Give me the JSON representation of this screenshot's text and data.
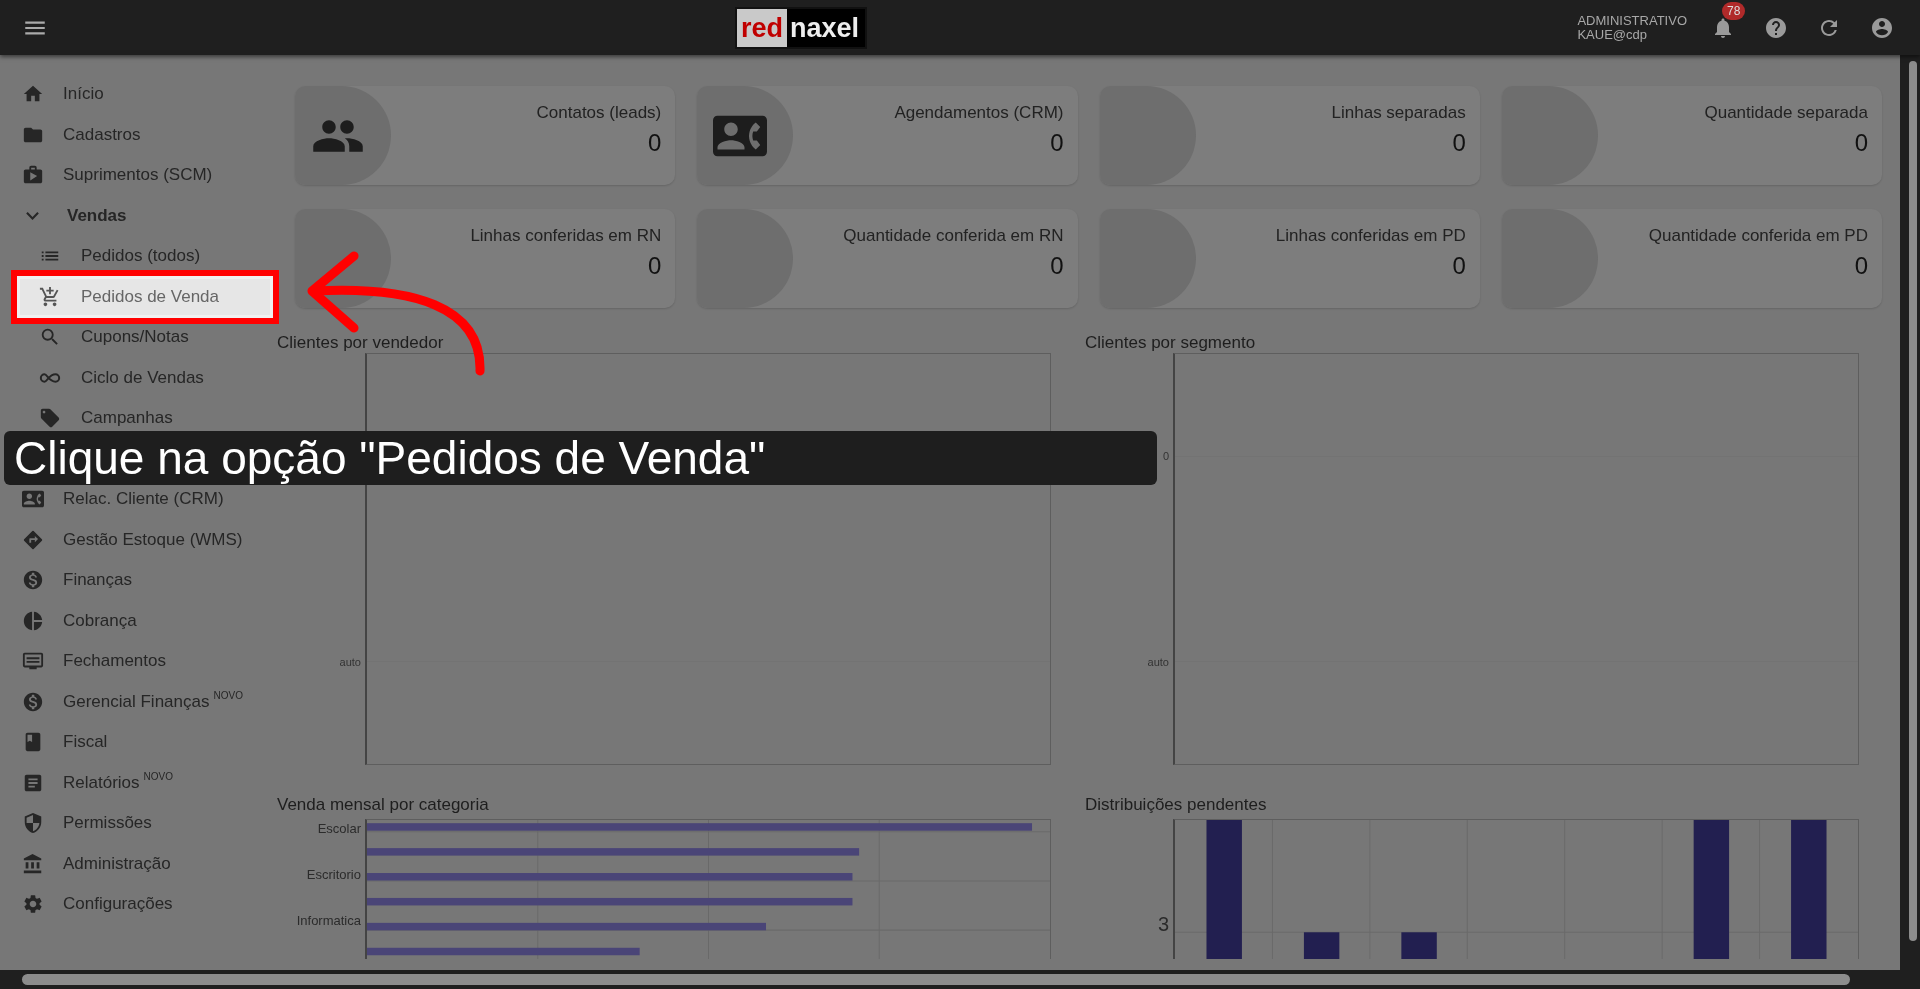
{
  "topbar": {
    "logo": {
      "part_1": "red",
      "part_2": "naxel"
    },
    "user": {
      "role": "ADMINISTRATIVO",
      "login": "KAUE@cdp"
    },
    "notifications": {
      "count": "78"
    }
  },
  "sidebar": {
    "items": [
      {
        "label": "Início"
      },
      {
        "label": "Cadastros"
      },
      {
        "label": "Suprimentos (SCM)"
      },
      {
        "label": "Vendas",
        "expanded": true,
        "children": [
          {
            "label": "Pedidos (todos)",
            "selected": false
          },
          {
            "label": "Pedidos de Venda",
            "selected": true
          },
          {
            "label": "Cupons/Notas",
            "selected": false
          },
          {
            "label": "Ciclo de Vendas",
            "selected": false
          },
          {
            "label": "Campanhas",
            "selected": false
          }
        ]
      },
      {
        "label": "Relac. Cliente (CRM)"
      },
      {
        "label": "Gestão Estoque (WMS)"
      },
      {
        "label": "Finanças"
      },
      {
        "label": "Cobrança"
      },
      {
        "label": "Fechamentos"
      },
      {
        "label": "Gerencial Finanças",
        "badge": "NOVO"
      },
      {
        "label": "Fiscal"
      },
      {
        "label": "Relatórios",
        "badge": "NOVO"
      },
      {
        "label": "Permissões"
      },
      {
        "label": "Administração"
      },
      {
        "label": "Configurações"
      }
    ]
  },
  "cards": [
    {
      "label": "Contatos (leads)",
      "value": "0"
    },
    {
      "label": "Agendamentos (CRM)",
      "value": "0"
    },
    {
      "label": "Linhas separadas",
      "value": "0"
    },
    {
      "label": "Quantidade separada",
      "value": "0"
    },
    {
      "label": "Linhas conferidas em RN",
      "value": "0"
    },
    {
      "label": "Quantidade conferida em RN",
      "value": "0"
    },
    {
      "label": "Linhas conferidas em PD",
      "value": "0"
    },
    {
      "label": "Quantidade conferida em PD",
      "value": "0"
    }
  ],
  "charts": [
    {
      "kind": "empty",
      "title": "Clientes por vendedor",
      "y_tick_labels": [
        "auto"
      ]
    },
    {
      "kind": "empty",
      "title": "Clientes por segmento",
      "y_tick_labels": [
        "0",
        "auto"
      ]
    },
    {
      "kind": "hbar",
      "title": "Venda mensal por categoria",
      "category_labels": [
        "Escolar",
        "Escritorio",
        "Informatica"
      ]
    },
    {
      "kind": "vbar",
      "title": "Distribuições pendentes",
      "y_tick_labels": [
        "3"
      ]
    }
  ],
  "tutorial": {
    "caption": "Clique na opção \"Pedidos de Venda\""
  }
}
